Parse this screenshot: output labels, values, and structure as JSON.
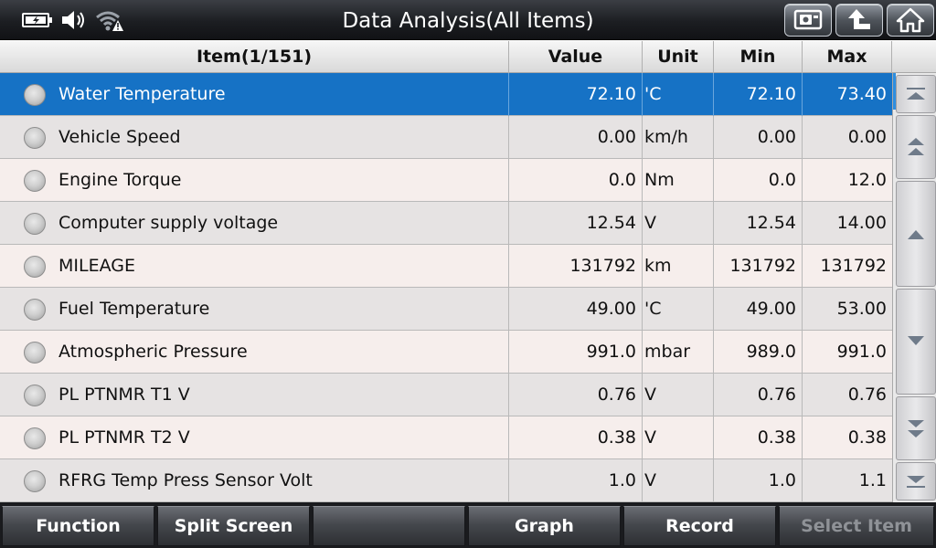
{
  "header": {
    "title": "Data Analysis(All Items)"
  },
  "icons": {
    "battery": "battery-charging-icon",
    "speaker": "speaker-icon",
    "wifi": "wifi-warning-icon",
    "screenshot": "camera-screen-icon",
    "back": "back-arrow-icon",
    "home": "home-icon"
  },
  "table": {
    "columns": {
      "item": "Item(1/151)",
      "value": "Value",
      "unit": "Unit",
      "min": "Min",
      "max": "Max"
    },
    "rows": [
      {
        "item": "Water Temperature",
        "value": "72.10",
        "unit": "'C",
        "min": "72.10",
        "max": "73.40"
      },
      {
        "item": "Vehicle Speed",
        "value": "0.00",
        "unit": "km/h",
        "min": "0.00",
        "max": "0.00"
      },
      {
        "item": "Engine Torque",
        "value": "0.0",
        "unit": "Nm",
        "min": "0.0",
        "max": "12.0"
      },
      {
        "item": "Computer supply voltage",
        "value": "12.54",
        "unit": "V",
        "min": "12.54",
        "max": "14.00"
      },
      {
        "item": "MILEAGE",
        "value": "131792",
        "unit": "km",
        "min": "131792",
        "max": "131792"
      },
      {
        "item": "Fuel Temperature",
        "value": "49.00",
        "unit": "'C",
        "min": "49.00",
        "max": "53.00"
      },
      {
        "item": "Atmospheric Pressure",
        "value": "991.0",
        "unit": "mbar",
        "min": "989.0",
        "max": "991.0"
      },
      {
        "item": "PL PTNMR T1 V",
        "value": "0.76",
        "unit": "V",
        "min": "0.76",
        "max": "0.76"
      },
      {
        "item": "PL PTNMR T2 V",
        "value": "0.38",
        "unit": "V",
        "min": "0.38",
        "max": "0.38"
      },
      {
        "item": "RFRG Temp Press Sensor Volt",
        "value": "1.0",
        "unit": "V",
        "min": "1.0",
        "max": "1.1"
      }
    ],
    "selected_row": 0
  },
  "scroll": {
    "buttons": [
      "scroll-top-icon",
      "page-up-icon",
      "line-up-icon",
      "line-down-icon",
      "page-down-icon",
      "scroll-bottom-icon"
    ]
  },
  "toolbar": {
    "function": "Function",
    "split_screen": "Split Screen",
    "empty": "",
    "graph": "Graph",
    "record": "Record",
    "select_item": "Select Item"
  },
  "colors": {
    "selected_row": "#1672c5",
    "row_odd": "#f6eeec",
    "row_even": "#e6e3e3",
    "title_bar": "#1c1e22"
  }
}
